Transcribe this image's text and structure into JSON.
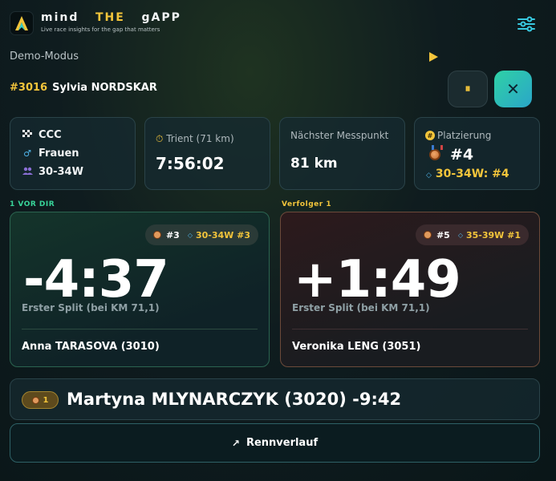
{
  "header": {
    "brand_word1": "mind",
    "brand_word2": "THE",
    "brand_word3": "gAPP",
    "tagline": "Live race insights for the gap that matters",
    "menu_icon": "sliders-icon",
    "accent_color": "#f3c53b",
    "teal_color": "#2fd1a5"
  },
  "mode": {
    "label": "Demo-Modus",
    "play_icon": "play-icon"
  },
  "runner": {
    "bib": "#3016",
    "name": "Sylvia NORDSKAR"
  },
  "controls": {
    "pause_label": "⏸",
    "close_label": "✕"
  },
  "info": {
    "race": "CCC",
    "gender": "Frauen",
    "age_group": "30-34W",
    "segment_label": "Trient (71 km)",
    "segment_time": "7:56:02",
    "next_label": "Nächster Messpunkt",
    "next_value": "81 km",
    "placement_label": "Platzierung",
    "placement_rank": "#4",
    "placement_cat": "30-34W: #4"
  },
  "ahead": {
    "section_label": "1 VOR DIR",
    "rank": "#3",
    "cat_rank": "30-34W #3",
    "gap": "-4:37",
    "note": "Erster Split (bei KM 71,1)",
    "name": "Anna TARASOVA (3010)"
  },
  "behind": {
    "section_label": "Verfolger 1",
    "rank": "#5",
    "cat_rank": "35-39W #1",
    "gap": "+1:49",
    "note": "Erster Split (bei KM 71,1)",
    "name": "Veronika LENG (3051)"
  },
  "leader": {
    "badge": "1",
    "text": "Martyna MLYNARCZYK (3020) -9:42"
  },
  "history": {
    "arrow": "↗",
    "label": "Rennverlauf"
  }
}
